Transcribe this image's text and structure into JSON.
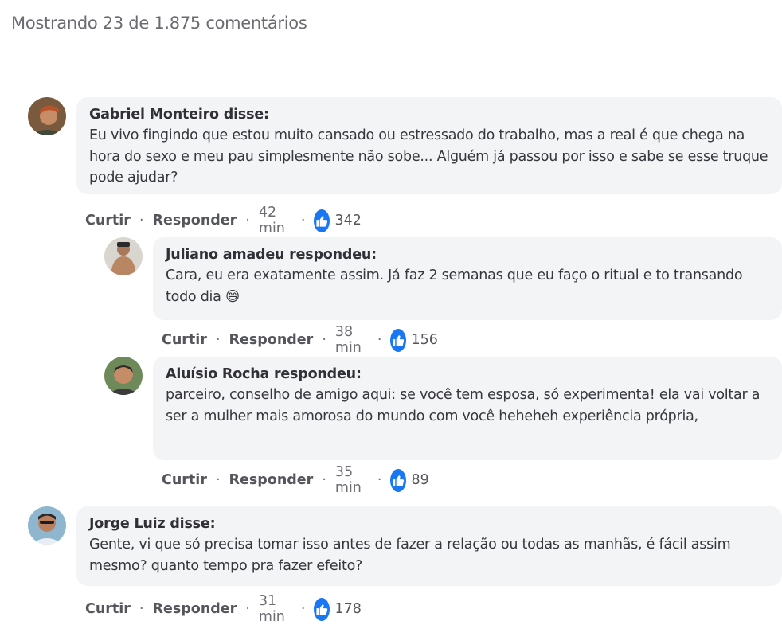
{
  "header": {
    "title": "Mostrando 23 de 1.875 comentários"
  },
  "actions_labels": {
    "like": "Curtir",
    "reply": "Responder",
    "separator": "·"
  },
  "comments": [
    {
      "author": "Gabriel Monteiro disse:",
      "text": "Eu vivo fingindo que estou muito cansado ou estressado do trabalho, mas a real é que chega na hora do sexo e meu pau simplesmente não sobe... Alguém já passou por isso e sabe se esse truque pode ajudar?",
      "time": "42 min",
      "likes": "342"
    },
    {
      "author": "Juliano amadeu respondeu:",
      "text": "Cara, eu era exatamente assim. Já faz 2 semanas que eu faço o ritual e to transando todo dia 😅",
      "time": "38 min",
      "likes": "156"
    },
    {
      "author": "Aluísio Rocha respondeu:",
      "text": "parceiro, conselho de amigo aqui: se você tem esposa, só experimenta! ela vai voltar a ser a mulher mais amorosa do mundo com você heheheh experiência própria,",
      "time": "35 min",
      "likes": "89"
    },
    {
      "author": "Jorge Luiz disse:",
      "text": "Gente, vi que só precisa tomar isso antes de fazer a relação ou todas as manhãs, é fácil assim mesmo? quanto tempo pra fazer efeito?",
      "time": "31 min",
      "likes": "178"
    }
  ],
  "icons": {
    "like": "thumbs-up-icon",
    "avatar": "user-avatar"
  },
  "colors": {
    "like_badge": "#1877f2",
    "bubble_bg": "#f3f4f6"
  }
}
